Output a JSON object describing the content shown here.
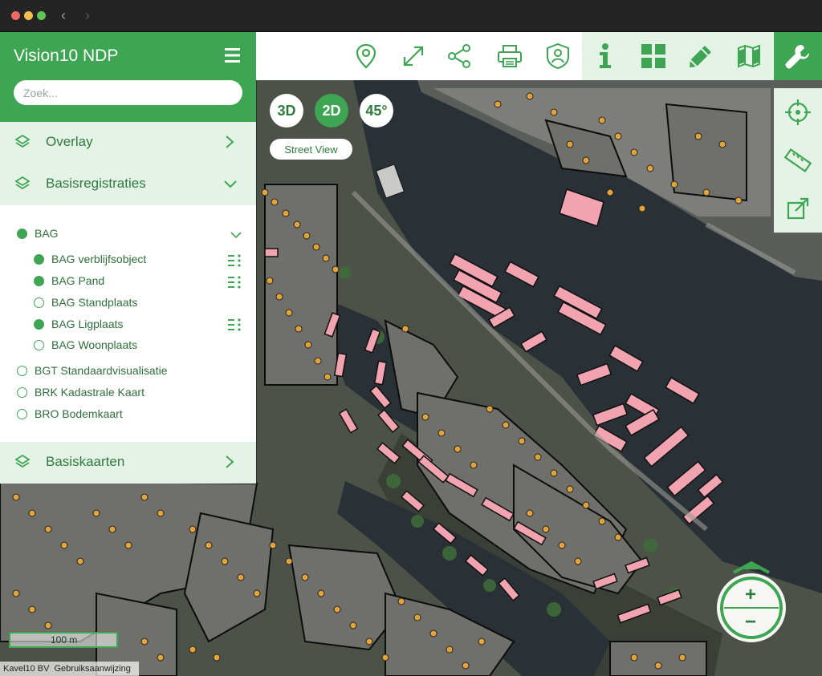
{
  "app": {
    "title": "Vision10 NDP"
  },
  "search": {
    "placeholder": "Zoek..."
  },
  "sections": {
    "overlay": "Overlay",
    "basisregistraties": "Basisregistraties",
    "basiskaarten": "Basiskaarten"
  },
  "layers": {
    "bag": {
      "label": "BAG",
      "active": true
    },
    "bag_verblijfsobject": {
      "label": "BAG verblijfsobject",
      "active": true
    },
    "bag_pand": {
      "label": "BAG Pand",
      "active": true
    },
    "bag_standplaats": {
      "label": "BAG Standplaats",
      "active": false
    },
    "bag_ligplaats": {
      "label": "BAG Ligplaats",
      "active": true
    },
    "bag_woonplaats": {
      "label": "BAG Woonplaats",
      "active": false
    },
    "bgt": {
      "label": "BGT Standaardvisualisatie",
      "active": false
    },
    "brk": {
      "label": "BRK Kadastrale Kaart",
      "active": false
    },
    "bro": {
      "label": "BRO Bodemkaart",
      "active": false
    }
  },
  "view_modes": {
    "mode_3d": "3D",
    "mode_2d": "2D",
    "mode_45": "45°",
    "active": "2D"
  },
  "street_view": "Street View",
  "toolbar_icons": [
    "location-pin-icon",
    "fullscreen-icon",
    "share-icon",
    "print-icon",
    "user-shield-icon",
    "info-icon",
    "grid-icon",
    "pencil-icon",
    "map-icon",
    "wrench-icon"
  ],
  "side_tools_icons": [
    "crosshair-icon",
    "ruler-icon",
    "external-link-icon"
  ],
  "zoom": {
    "in": "+",
    "out": "−"
  },
  "scalebar": {
    "label": "100 m"
  },
  "footer": {
    "company": "Kavel10 BV",
    "manual": "Gebruiksaanwijzing"
  },
  "colors": {
    "brand": "#3ea552",
    "brand_light": "#e4f3e6",
    "text_dark_green": "#2f7a3e",
    "building_fill": "#f2a3b0",
    "address_dot": "#e3a33a",
    "water": "#2a3136"
  }
}
